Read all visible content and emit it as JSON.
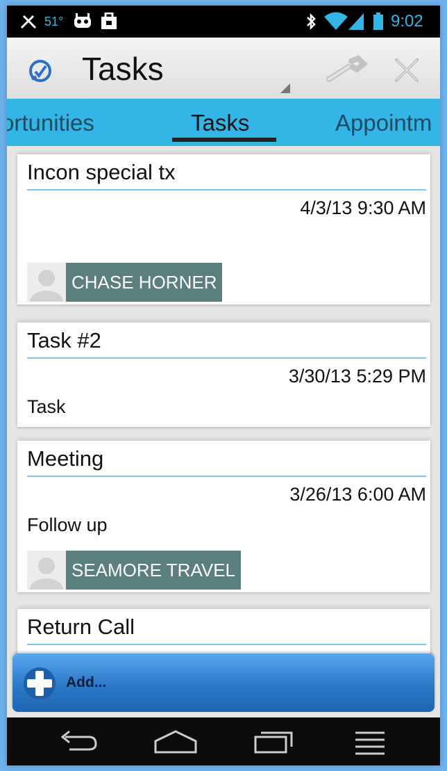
{
  "status_bar": {
    "temperature": "51°",
    "time": "9:02",
    "icons": [
      "notification-icon",
      "android-icon",
      "shopping-bag-icon",
      "bluetooth-icon",
      "wifi-icon",
      "signal-icon",
      "battery-icon"
    ]
  },
  "action_bar": {
    "title": "Tasks",
    "icons": [
      "app-logo-icon",
      "wrench-icon",
      "close-icon"
    ]
  },
  "tabs": [
    {
      "label": "ortunities"
    },
    {
      "label": "Tasks"
    },
    {
      "label": "Appointm"
    }
  ],
  "tasks": [
    {
      "title": "Incon special tx",
      "datetime": "4/3/13 9:30 AM",
      "description": "",
      "contact": "CHASE HORNER"
    },
    {
      "title": "Task #2",
      "datetime": "3/30/13 5:29 PM",
      "description": "Task",
      "contact": ""
    },
    {
      "title": "Meeting",
      "datetime": "3/26/13 6:00 AM",
      "description": "Follow  up",
      "contact": "SEAMORE TRAVEL"
    },
    {
      "title": "Return  Call",
      "datetime": "",
      "description": "",
      "contact": ""
    }
  ],
  "add_button": {
    "label": "Add..."
  },
  "nav_bar": {
    "icons": [
      "back-icon",
      "home-icon",
      "recent-apps-icon",
      "menu-icon"
    ]
  },
  "colors": {
    "accent": "#33b5e5",
    "contact_chip": "#5b7f7d",
    "add_bar": "#2a78c8"
  }
}
